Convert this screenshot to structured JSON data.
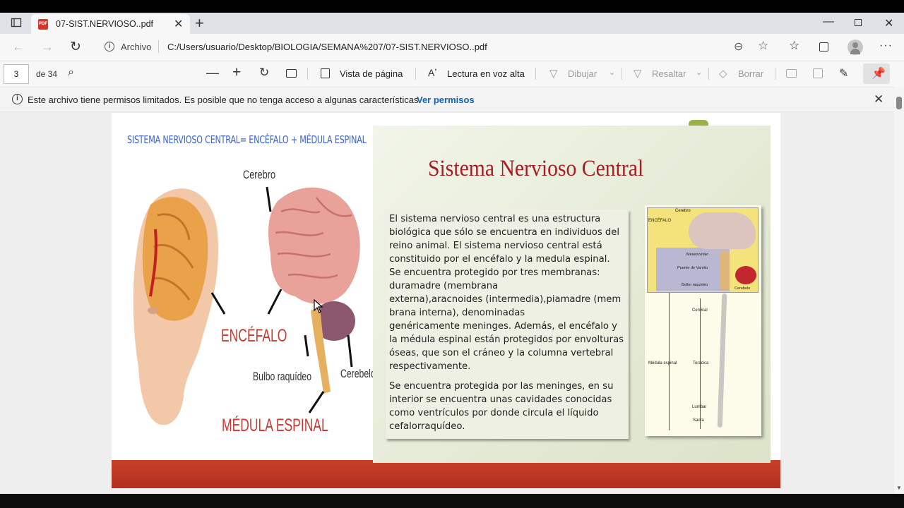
{
  "browser": {
    "tab_title": "07-SIST.NERVIOSO..pdf",
    "site_label": "Archivo",
    "url": "C:/Users/usuario/Desktop/BIOLOGIA/SEMANA%207/07-SIST.NERVIOSO..pdf"
  },
  "pdf_toolbar": {
    "page_number": "3",
    "page_total": "de 34",
    "page_view": "Vista de página",
    "read_aloud": "Lectura en voz alta",
    "draw": "Dibujar",
    "highlight": "Resaltar",
    "erase": "Borrar"
  },
  "notice": {
    "text": "Este archivo tiene permisos limitados. Es posible que no tenga acceso a algunas características.",
    "link": "Ver permisos"
  },
  "slide": {
    "heading": "SISTEMA NERVIOSO CENTRAL= ENCÉFALO + MÉDULA ESPINAL",
    "title": "Sistema Nervioso Central",
    "labels": {
      "cerebro": "Cerebro",
      "encefalo": "ENCÉFALO",
      "bulbo": "Bulbo raquídeo",
      "cerebelo": "Cerebelo",
      "medula": "MÉDULA ESPINAL"
    },
    "paragraph1": "El sistema nervioso central es una estructura\nbiológica que sólo se encuentra en individuos del\nreino animal. El sistema nervioso central está\nconstituido por el encéfalo  y la medula espinal.\nSe encuentra protegido por tres membranas:\nduramadre (membrana\nexterna),aracnoides (intermedia),piamadre (mem\nbrana interna), denominadas\ngenéricamente meninges. Además, el encéfalo y\nla médula espinal están protegidos por envolturas\nóseas, que son el cráneo y la columna vertebral\nrespectivamente.",
    "paragraph2": " Se encuentra protegida por las meninges, en su\ninterior se encuentra unas cavidades conocidas\ncomo ventrículos por donde circula el líquido\ncefalorraquídeo.",
    "figure": {
      "cerebro": "Cerebro",
      "encefalo": "ENCÉFALO",
      "mesencefalo": "Mesencéfalo",
      "puente": "Puente de Varolio",
      "bulbo": "Bulbo raquídeo",
      "cerebelo": "Cerebelo",
      "cervical": "Cervical",
      "toracica": "Torácica",
      "lumbar": "Lumbar",
      "sacra": "Sacra",
      "medula": "Médula espinal"
    }
  }
}
